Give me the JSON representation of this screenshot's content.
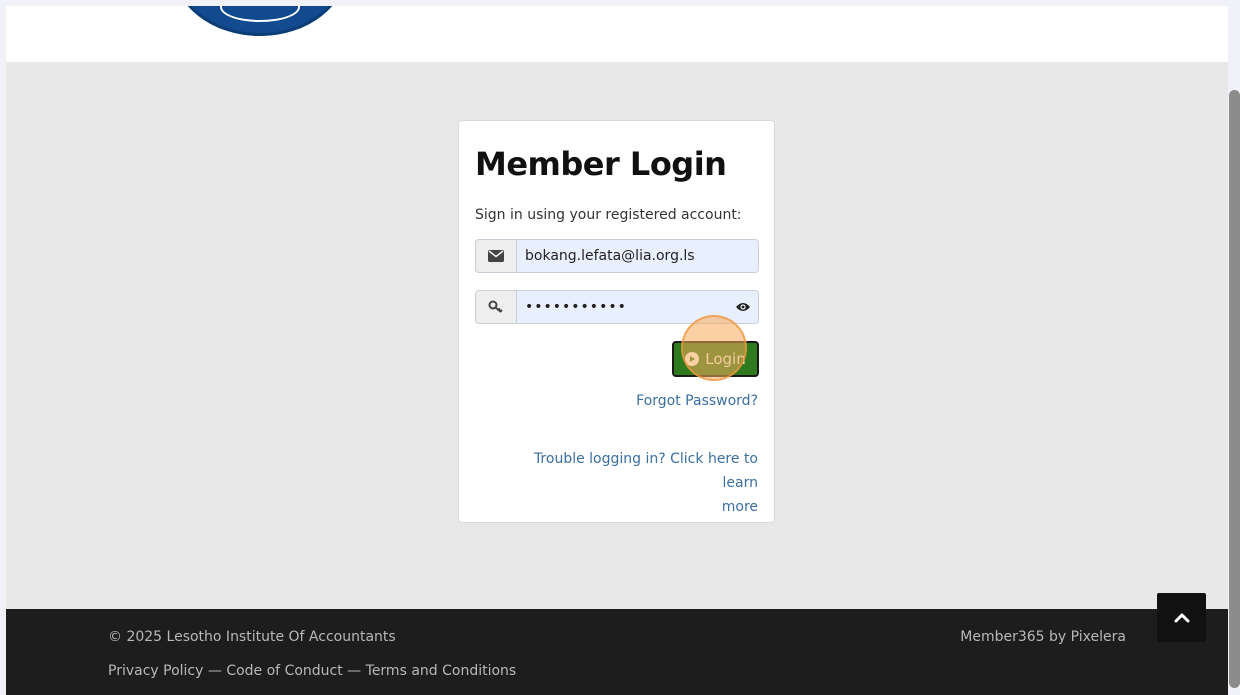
{
  "login": {
    "title": "Member Login",
    "subtitle": "Sign in using your registered account:",
    "email_value": "bokang.lefata@lia.org.ls",
    "password_value": "•••••••••••",
    "login_button": "Login",
    "forgot_password": "Forgot Password?",
    "trouble_line1": "Trouble logging in? Click here to learn",
    "trouble_line2": "more"
  },
  "icons": {
    "email": "envelope-icon",
    "password": "key-icon",
    "toggle": "eye-icon",
    "login": "play-circle-icon",
    "scroll": "chevron-up-icon"
  },
  "footer": {
    "copyright": "© 2025 Lesotho Institute Of Accountants",
    "privacy": "Privacy Policy",
    "conduct": "Code of Conduct",
    "terms": "Terms and Conditions",
    "separator": " — ",
    "credit": "Member365 by Pixelera"
  },
  "colors": {
    "login_button": "#2f7a1f",
    "link": "#3a6fa0",
    "footer_bg": "#1d1d1d",
    "logo": "#114a8e"
  }
}
